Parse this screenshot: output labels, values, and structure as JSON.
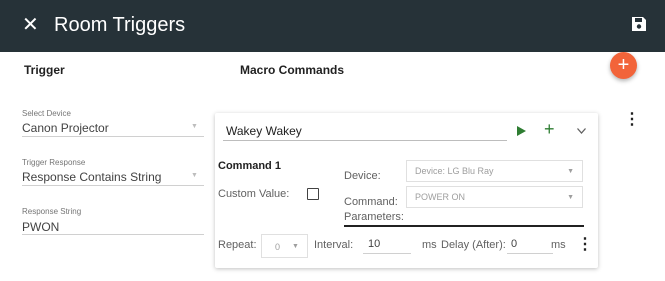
{
  "topbar": {
    "title": "Room Triggers",
    "close_icon": "close-icon",
    "save_icon": "save-icon"
  },
  "headers": {
    "trigger": "Trigger",
    "macro_commands": "Macro Commands"
  },
  "trigger": {
    "select_device": {
      "label": "Select Device",
      "value": "Canon Projector"
    },
    "trigger_response": {
      "label": "Trigger Response",
      "value": "Response Contains String"
    },
    "response_string": {
      "label": "Response String",
      "value": "PWON"
    }
  },
  "macro": {
    "name": "Wakey Wakey",
    "command_title": "Command 1",
    "custom_value_label": "Custom Value:",
    "custom_value_checked": false,
    "device_label": "Device:",
    "device_value": "Device: LG Blu Ray",
    "command_label": "Command:",
    "command_value": "POWER ON",
    "parameters_label": "Parameters:",
    "repeat_label": "Repeat:",
    "repeat_value": "0",
    "interval_label": "Interval:",
    "interval_value": "10",
    "interval_unit": "ms",
    "delay_label": "Delay (After):",
    "delay_value": "0",
    "delay_unit": "ms"
  },
  "colors": {
    "topbar": "#263238",
    "fab": "#f2643a",
    "play": "#2e7d32"
  }
}
